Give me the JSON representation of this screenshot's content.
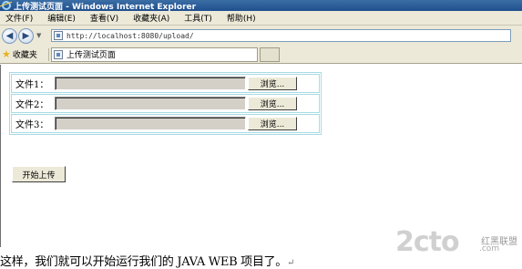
{
  "window": {
    "title": "上传测试页面 - Windows Internet Explorer"
  },
  "menu": {
    "items": [
      "文件(F)",
      "编辑(E)",
      "查看(V)",
      "收藏夹(A)",
      "工具(T)",
      "帮助(H)"
    ]
  },
  "address": {
    "url": "http://localhost:8080/upload/"
  },
  "favorites": {
    "label": "收藏夹",
    "tab_title": "上传测试页面"
  },
  "form": {
    "rows": [
      {
        "label": "文件1：",
        "value": "",
        "browse": "浏览..."
      },
      {
        "label": "文件2：",
        "value": "",
        "browse": "浏览..."
      },
      {
        "label": "文件3：",
        "value": "",
        "browse": "浏览..."
      }
    ],
    "submit": "开始上传"
  },
  "caption": {
    "text": "这样，我们就可以开始运行我们的 JAVA WEB 项目了。",
    "mark": "↵"
  },
  "watermark": {
    "logo": "2cto",
    "sub1": "红黑联盟",
    "sub2": ".com"
  },
  "colors": {
    "titlebar": "#1f4f8e",
    "chrome": "#ece9d8",
    "table_border": "#a9dbe3"
  }
}
